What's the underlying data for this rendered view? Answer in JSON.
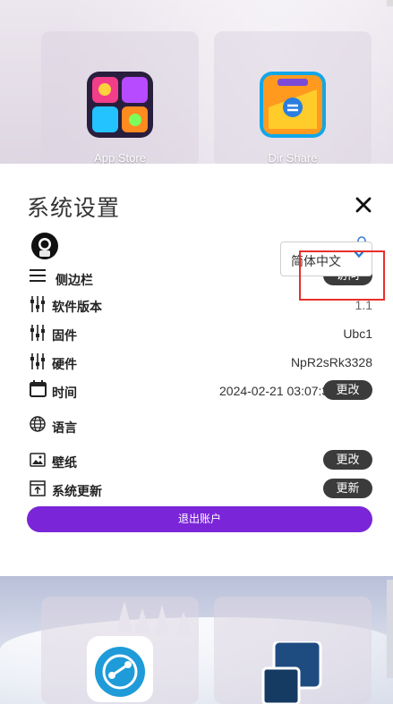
{
  "apps": [
    {
      "label": "App Store",
      "icon": "app-store-icon"
    },
    {
      "label": "Dir Share",
      "icon": "dir-share-icon"
    }
  ],
  "settings": {
    "title": "系统设置",
    "close_icon": "close-icon",
    "edit_profile_icon": "user-edit-icon",
    "sidebar": {
      "label": "侧边栏",
      "button": "访问"
    },
    "software_version": {
      "label": "软件版本",
      "value": "1.1"
    },
    "firmware": {
      "label": "固件",
      "value": "Ubc1"
    },
    "hardware": {
      "label": "硬件",
      "value": "NpR2sRk3328"
    },
    "time": {
      "label": "时间",
      "value": "2024-02-21 03:07:31",
      "button": "更改"
    },
    "language": {
      "label": "语言",
      "selected": "简体中文"
    },
    "wallpaper": {
      "label": "壁纸",
      "button": "更改"
    },
    "system_update": {
      "label": "系统更新",
      "button": "更新"
    },
    "logout": "退出账户"
  },
  "colors": {
    "accent": "#7a25d8",
    "pill": "#3b3b3b",
    "highlight": "#e8302a",
    "link_blue": "#3a7bd5"
  }
}
